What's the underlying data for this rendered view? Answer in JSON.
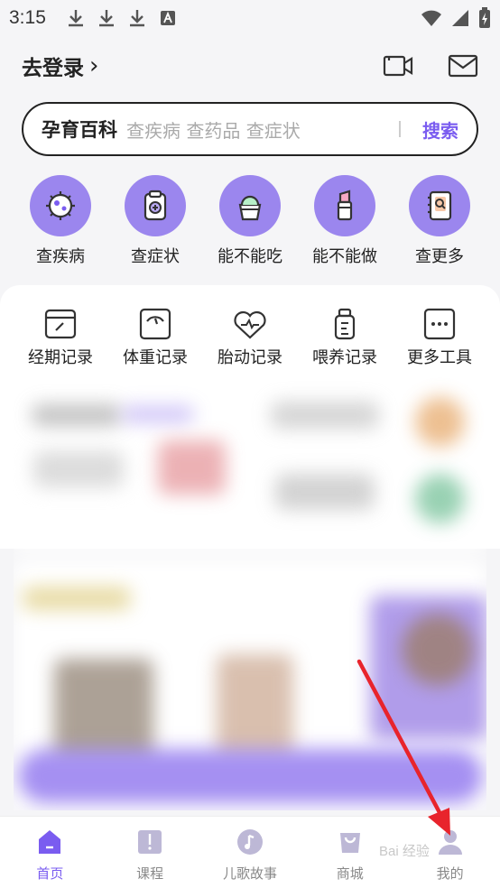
{
  "status_bar": {
    "time": "3:15"
  },
  "header": {
    "login_label": "去登录",
    "login_chevron": "›"
  },
  "search": {
    "brand": "孕育百科",
    "placeholder": "查疾病 查药品 查症状",
    "button_label": "搜索"
  },
  "quick_actions": [
    {
      "label": "查疾病",
      "icon": "virus-icon"
    },
    {
      "label": "查症状",
      "icon": "clipboard-plus-icon"
    },
    {
      "label": "能不能吃",
      "icon": "food-cup-icon"
    },
    {
      "label": "能不能做",
      "icon": "lipstick-icon"
    },
    {
      "label": "查更多",
      "icon": "book-search-icon"
    }
  ],
  "tools": [
    {
      "label": "经期记录",
      "icon": "calendar-pen-icon"
    },
    {
      "label": "体重记录",
      "icon": "scale-icon"
    },
    {
      "label": "胎动记录",
      "icon": "heartbeat-icon"
    },
    {
      "label": "喂养记录",
      "icon": "bottle-icon"
    },
    {
      "label": "更多工具",
      "icon": "more-dots-icon"
    }
  ],
  "tab_bar": [
    {
      "label": "首页",
      "active": true
    },
    {
      "label": "课程",
      "active": false
    },
    {
      "label": "儿歌故事",
      "active": false
    },
    {
      "label": "商城",
      "active": false
    },
    {
      "label": "我的",
      "active": false
    }
  ],
  "watermark": "Bai 经验",
  "colors": {
    "accent": "#7a5cf0",
    "quick_circle": "#9b86ee",
    "annotation_arrow": "#e8242c"
  }
}
